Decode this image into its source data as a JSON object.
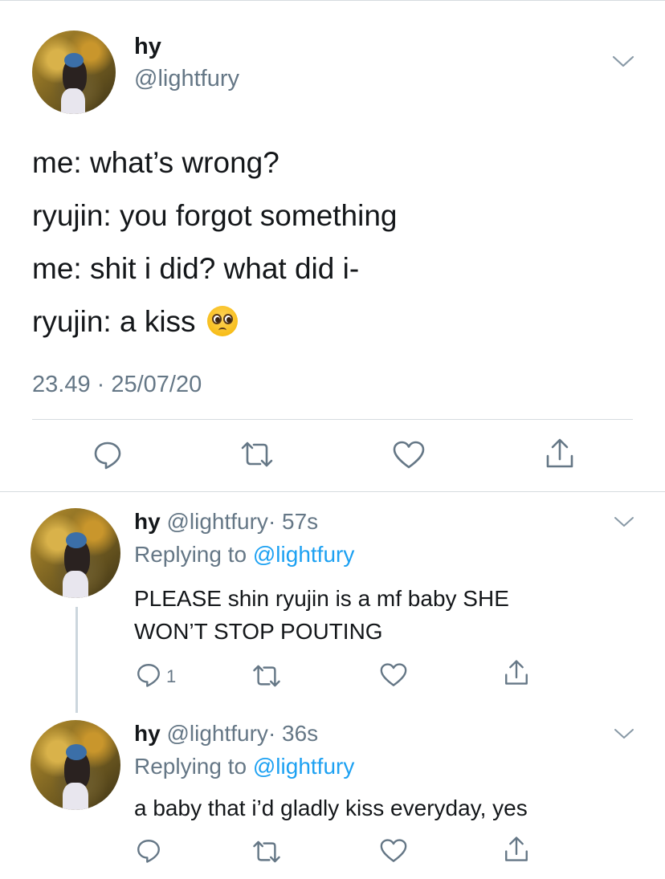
{
  "main_tweet": {
    "name": "hy",
    "handle": "@lightfury",
    "lines": [
      "me: what’s wrong?",
      "ryujin: you forgot something",
      "me: shit i did? what did i-",
      "ryujin: a kiss"
    ],
    "emoji": "pleading-face",
    "timestamp": "23.49 · 25/07/20"
  },
  "replies": [
    {
      "name": "hy",
      "handle": "@lightfury",
      "time": "· 57s",
      "replying_prefix": "Replying to",
      "replying_to": "@lightfury",
      "text_lines": [
        "PLEASE shin ryujin is a mf baby SHE",
        "WON’T STOP POUTING"
      ],
      "reply_count": "1"
    },
    {
      "name": "hy",
      "handle": "@lightfury",
      "time": "· 36s",
      "replying_prefix": "Replying to",
      "replying_to": "@lightfury",
      "text_lines": [
        "a baby that i’d gladly kiss everyday, yes"
      ],
      "reply_count": ""
    }
  ],
  "icons": [
    "reply-icon",
    "retweet-icon",
    "like-icon",
    "share-icon",
    "chevron-down-icon"
  ],
  "colors": {
    "text": "#14171a",
    "secondary": "#657786",
    "link": "#1da1f2",
    "divider": "#d6dbdf"
  }
}
